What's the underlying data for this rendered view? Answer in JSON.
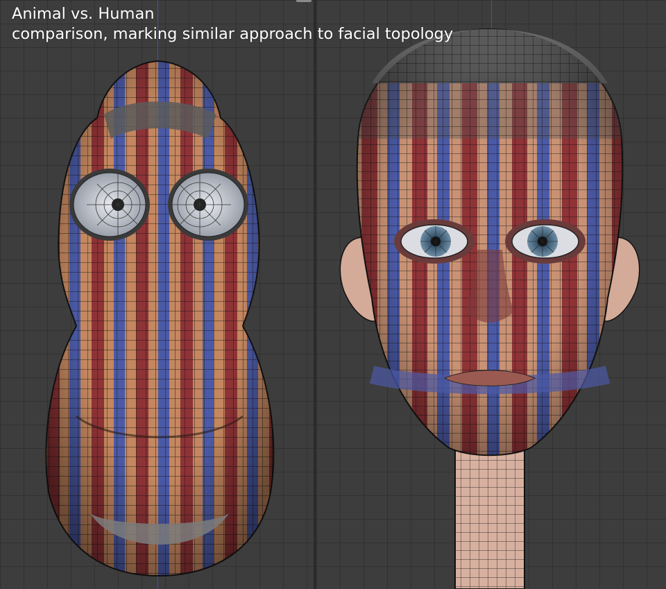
{
  "caption": {
    "title": "Animal vs. Human",
    "subtitle": "comparison, marking similar approach to facial topology"
  },
  "colors": {
    "background": "#3d3d3d",
    "skin": "#c48a63",
    "stripe_red": "#8e3336",
    "stripe_blue": "#4a5aa8",
    "wire": "#1a1a1a",
    "eye_white": "#cfd2d8",
    "iris": "#4f6e86"
  },
  "viewports": [
    {
      "name": "animal-viewport",
      "subject": "animal-head-model"
    },
    {
      "name": "human-viewport",
      "subject": "human-head-model"
    }
  ]
}
